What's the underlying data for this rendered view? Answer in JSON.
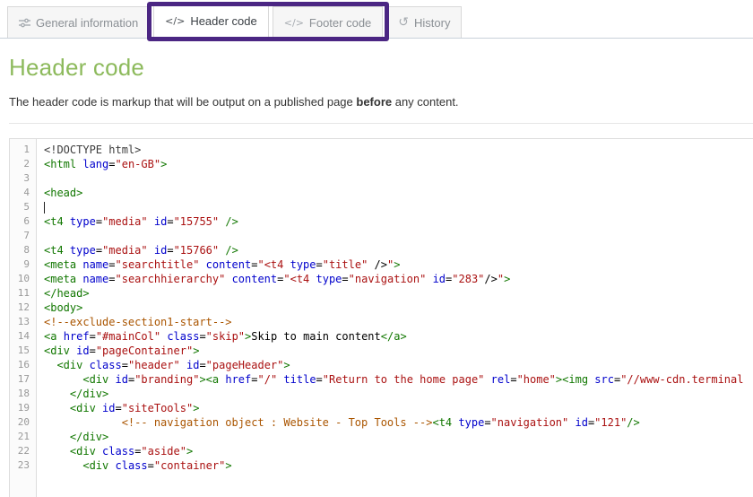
{
  "tabs": {
    "items": [
      {
        "label": "General information",
        "icon": "sliders-icon",
        "active": false
      },
      {
        "label": "Header code",
        "icon": "code-icon",
        "active": true
      },
      {
        "label": "Footer code",
        "icon": "code-icon",
        "active": false
      },
      {
        "label": "History",
        "icon": "history-icon",
        "active": false
      }
    ],
    "code_icon_glyph": "</>",
    "history_icon_glyph": "↺",
    "active_accent_color": "#568dbb"
  },
  "annotation": {
    "shape": "rectangle-outline",
    "color": "#4b2683",
    "highlights_tabs": [
      "Header code",
      "Footer code"
    ]
  },
  "main": {
    "title": "Header code",
    "title_color": "#8dba5c",
    "description": {
      "before": "The header code is markup that will be output on a published page ",
      "bold": "before",
      "after": " any content."
    }
  },
  "editor": {
    "cursor_line": 5,
    "line_count": 23,
    "colors": {
      "tag": "#117700",
      "attr": "#0000cc",
      "string": "#aa1111",
      "comment": "#aa5500",
      "meta": "#3c3c3c",
      "line_number": "#999999"
    },
    "lines": [
      [
        [
          "m",
          "<!DOCTYPE html>"
        ]
      ],
      [
        [
          "t",
          "<html"
        ],
        [
          "p",
          " "
        ],
        [
          "a",
          "lang"
        ],
        [
          "p",
          "="
        ],
        [
          "s",
          "\"en-GB\""
        ],
        [
          "t",
          ">"
        ]
      ],
      [],
      [
        [
          "t",
          "<head>"
        ]
      ],
      [],
      [
        [
          "t",
          "<t4"
        ],
        [
          "p",
          " "
        ],
        [
          "a",
          "type"
        ],
        [
          "p",
          "="
        ],
        [
          "s",
          "\"media\""
        ],
        [
          "p",
          " "
        ],
        [
          "a",
          "id"
        ],
        [
          "p",
          "="
        ],
        [
          "s",
          "\"15755\""
        ],
        [
          "p",
          " "
        ],
        [
          "t",
          "/>"
        ]
      ],
      [],
      [
        [
          "t",
          "<t4"
        ],
        [
          "p",
          " "
        ],
        [
          "a",
          "type"
        ],
        [
          "p",
          "="
        ],
        [
          "s",
          "\"media\""
        ],
        [
          "p",
          " "
        ],
        [
          "a",
          "id"
        ],
        [
          "p",
          "="
        ],
        [
          "s",
          "\"15766\""
        ],
        [
          "p",
          " "
        ],
        [
          "t",
          "/>"
        ]
      ],
      [
        [
          "t",
          "<meta"
        ],
        [
          "p",
          " "
        ],
        [
          "a",
          "name"
        ],
        [
          "p",
          "="
        ],
        [
          "s",
          "\"searchtitle\""
        ],
        [
          "p",
          " "
        ],
        [
          "a",
          "content"
        ],
        [
          "p",
          "="
        ],
        [
          "s",
          "\"<t4 "
        ],
        [
          "a",
          "type"
        ],
        [
          "p",
          "="
        ],
        [
          "s",
          "\"title\""
        ],
        [
          "p",
          " />"
        ],
        [
          "s",
          "\""
        ],
        [
          "t",
          ">"
        ]
      ],
      [
        [
          "t",
          "<meta"
        ],
        [
          "p",
          " "
        ],
        [
          "a",
          "name"
        ],
        [
          "p",
          "="
        ],
        [
          "s",
          "\"searchhierarchy\""
        ],
        [
          "p",
          " "
        ],
        [
          "a",
          "content"
        ],
        [
          "p",
          "="
        ],
        [
          "s",
          "\"<t4 "
        ],
        [
          "a",
          "type"
        ],
        [
          "p",
          "="
        ],
        [
          "s",
          "\"navigation\""
        ],
        [
          "p",
          " "
        ],
        [
          "a",
          "id"
        ],
        [
          "p",
          "="
        ],
        [
          "s",
          "\"283\""
        ],
        [
          "p",
          "/>"
        ],
        [
          "s",
          "\""
        ],
        [
          "t",
          ">"
        ]
      ],
      [
        [
          "t",
          "</head>"
        ]
      ],
      [
        [
          "t",
          "<body>"
        ]
      ],
      [
        [
          "c",
          "<!--exclude-section1-start-->"
        ]
      ],
      [
        [
          "t",
          "<a"
        ],
        [
          "p",
          " "
        ],
        [
          "a",
          "href"
        ],
        [
          "p",
          "="
        ],
        [
          "s",
          "\"#mainCol\""
        ],
        [
          "p",
          " "
        ],
        [
          "a",
          "class"
        ],
        [
          "p",
          "="
        ],
        [
          "s",
          "\"skip\""
        ],
        [
          "t",
          ">"
        ],
        [
          "p",
          "Skip to main content"
        ],
        [
          "t",
          "</a>"
        ]
      ],
      [
        [
          "t",
          "<div"
        ],
        [
          "p",
          " "
        ],
        [
          "a",
          "id"
        ],
        [
          "p",
          "="
        ],
        [
          "s",
          "\"pageContainer\""
        ],
        [
          "t",
          ">"
        ]
      ],
      [
        [
          "p",
          "  "
        ],
        [
          "t",
          "<div"
        ],
        [
          "p",
          " "
        ],
        [
          "a",
          "class"
        ],
        [
          "p",
          "="
        ],
        [
          "s",
          "\"header\""
        ],
        [
          "p",
          " "
        ],
        [
          "a",
          "id"
        ],
        [
          "p",
          "="
        ],
        [
          "s",
          "\"pageHeader\""
        ],
        [
          "t",
          ">"
        ]
      ],
      [
        [
          "p",
          "      "
        ],
        [
          "t",
          "<div"
        ],
        [
          "p",
          " "
        ],
        [
          "a",
          "id"
        ],
        [
          "p",
          "="
        ],
        [
          "s",
          "\"branding\""
        ],
        [
          "t",
          "><a"
        ],
        [
          "p",
          " "
        ],
        [
          "a",
          "href"
        ],
        [
          "p",
          "="
        ],
        [
          "s",
          "\"/\""
        ],
        [
          "p",
          " "
        ],
        [
          "a",
          "title"
        ],
        [
          "p",
          "="
        ],
        [
          "s",
          "\"Return to the home page\""
        ],
        [
          "p",
          " "
        ],
        [
          "a",
          "rel"
        ],
        [
          "p",
          "="
        ],
        [
          "s",
          "\"home\""
        ],
        [
          "t",
          "><img"
        ],
        [
          "p",
          " "
        ],
        [
          "a",
          "src"
        ],
        [
          "p",
          "="
        ],
        [
          "s",
          "\"//www-cdn.terminal"
        ]
      ],
      [
        [
          "p",
          "    "
        ],
        [
          "t",
          "</div>"
        ]
      ],
      [
        [
          "p",
          "    "
        ],
        [
          "t",
          "<div"
        ],
        [
          "p",
          " "
        ],
        [
          "a",
          "id"
        ],
        [
          "p",
          "="
        ],
        [
          "s",
          "\"siteTools\""
        ],
        [
          "t",
          ">"
        ]
      ],
      [
        [
          "p",
          "            "
        ],
        [
          "c",
          "<!-- navigation object : Website - Top Tools -->"
        ],
        [
          "t",
          "<t4"
        ],
        [
          "p",
          " "
        ],
        [
          "a",
          "type"
        ],
        [
          "p",
          "="
        ],
        [
          "s",
          "\"navigation\""
        ],
        [
          "p",
          " "
        ],
        [
          "a",
          "id"
        ],
        [
          "p",
          "="
        ],
        [
          "s",
          "\"121\""
        ],
        [
          "t",
          "/>"
        ]
      ],
      [
        [
          "p",
          "    "
        ],
        [
          "t",
          "</div>"
        ]
      ],
      [
        [
          "p",
          "    "
        ],
        [
          "t",
          "<div"
        ],
        [
          "p",
          " "
        ],
        [
          "a",
          "class"
        ],
        [
          "p",
          "="
        ],
        [
          "s",
          "\"aside\""
        ],
        [
          "t",
          ">"
        ]
      ],
      [
        [
          "p",
          "      "
        ],
        [
          "t",
          "<div"
        ],
        [
          "p",
          " "
        ],
        [
          "a",
          "class"
        ],
        [
          "p",
          "="
        ],
        [
          "s",
          "\"container\""
        ],
        [
          "t",
          ">"
        ]
      ]
    ]
  }
}
